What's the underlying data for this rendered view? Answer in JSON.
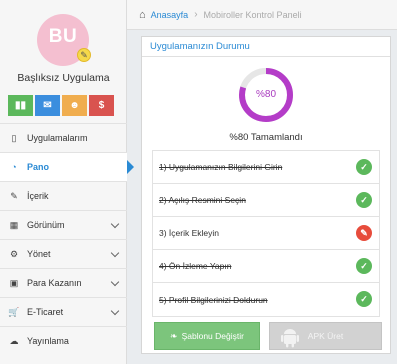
{
  "profile": {
    "initials": "BU",
    "app_name": "Başlıksız Uygulama",
    "avatar_color": "#f4bfd0"
  },
  "quick_buttons": [
    {
      "icon": "bar-chart-icon",
      "glyph": "▮▮",
      "color": "#5cb85c"
    },
    {
      "icon": "mail-icon",
      "glyph": "✉",
      "color": "#3b8ede"
    },
    {
      "icon": "users-icon",
      "glyph": "☻",
      "color": "#f0ad4e"
    },
    {
      "icon": "dollar-icon",
      "glyph": "$",
      "color": "#d9534f"
    }
  ],
  "menu": {
    "items": [
      {
        "label": "Uygulamalarım",
        "icon": "mobile-icon",
        "glyph": "▯"
      },
      {
        "label": "Pano",
        "icon": "dashboard-icon",
        "glyph": "◔",
        "active": true
      },
      {
        "label": "İçerik",
        "icon": "edit-icon",
        "glyph": "✎"
      },
      {
        "label": "Görünüm",
        "icon": "grid-icon",
        "glyph": "▦"
      },
      {
        "label": "Yönet",
        "icon": "cogs-icon",
        "glyph": "⚙"
      },
      {
        "label": "Para Kazanın",
        "icon": "money-icon",
        "glyph": "▣"
      },
      {
        "label": "E-Ticaret",
        "icon": "cart-icon",
        "glyph": "🛒"
      },
      {
        "label": "Yayınlama",
        "icon": "cloud-upload-icon",
        "glyph": "☁"
      }
    ]
  },
  "breadcrumb": {
    "home": "Anasayfa",
    "separator": "›",
    "current": "Mobiroller Kontrol Paneli"
  },
  "status_panel": {
    "title": "Uygulamanızın Durumu",
    "progress_label": "%80",
    "progress_value": 0.8,
    "completed_text": "%80 Tamamlandı",
    "accent_color": "#b43cc8"
  },
  "tasks": [
    {
      "label": "1) Uygulamanızın Bilgilerini Girin",
      "done": true
    },
    {
      "label": "2) Açılış Resmini Seçin",
      "done": true
    },
    {
      "label": "3) İçerik Ekleyin",
      "done": false
    },
    {
      "label": "4) Ön İzleme Yapın",
      "done": true
    },
    {
      "label": "5) Profil Bilgilerinizi Doldurun",
      "done": true
    }
  ],
  "buttons": {
    "change_template": "Şablonu Değiştir",
    "apk_build": "APK Üret"
  }
}
